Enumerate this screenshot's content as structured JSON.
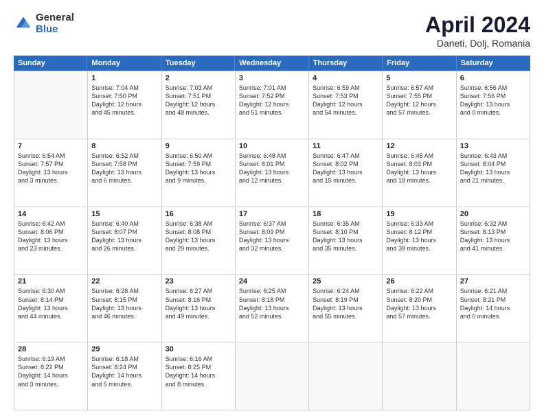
{
  "logo": {
    "general": "General",
    "blue": "Blue"
  },
  "title": {
    "month": "April 2024",
    "location": "Daneti, Dolj, Romania"
  },
  "header": {
    "days": [
      "Sunday",
      "Monday",
      "Tuesday",
      "Wednesday",
      "Thursday",
      "Friday",
      "Saturday"
    ]
  },
  "weeks": [
    [
      {
        "num": "",
        "lines": []
      },
      {
        "num": "1",
        "lines": [
          "Sunrise: 7:04 AM",
          "Sunset: 7:50 PM",
          "Daylight: 12 hours",
          "and 45 minutes."
        ]
      },
      {
        "num": "2",
        "lines": [
          "Sunrise: 7:03 AM",
          "Sunset: 7:51 PM",
          "Daylight: 12 hours",
          "and 48 minutes."
        ]
      },
      {
        "num": "3",
        "lines": [
          "Sunrise: 7:01 AM",
          "Sunset: 7:52 PM",
          "Daylight: 12 hours",
          "and 51 minutes."
        ]
      },
      {
        "num": "4",
        "lines": [
          "Sunrise: 6:59 AM",
          "Sunset: 7:53 PM",
          "Daylight: 12 hours",
          "and 54 minutes."
        ]
      },
      {
        "num": "5",
        "lines": [
          "Sunrise: 6:57 AM",
          "Sunset: 7:55 PM",
          "Daylight: 12 hours",
          "and 57 minutes."
        ]
      },
      {
        "num": "6",
        "lines": [
          "Sunrise: 6:56 AM",
          "Sunset: 7:56 PM",
          "Daylight: 13 hours",
          "and 0 minutes."
        ]
      }
    ],
    [
      {
        "num": "7",
        "lines": [
          "Sunrise: 6:54 AM",
          "Sunset: 7:57 PM",
          "Daylight: 13 hours",
          "and 3 minutes."
        ]
      },
      {
        "num": "8",
        "lines": [
          "Sunrise: 6:52 AM",
          "Sunset: 7:58 PM",
          "Daylight: 13 hours",
          "and 6 minutes."
        ]
      },
      {
        "num": "9",
        "lines": [
          "Sunrise: 6:50 AM",
          "Sunset: 7:59 PM",
          "Daylight: 13 hours",
          "and 9 minutes."
        ]
      },
      {
        "num": "10",
        "lines": [
          "Sunrise: 6:48 AM",
          "Sunset: 8:01 PM",
          "Daylight: 13 hours",
          "and 12 minutes."
        ]
      },
      {
        "num": "11",
        "lines": [
          "Sunrise: 6:47 AM",
          "Sunset: 8:02 PM",
          "Daylight: 13 hours",
          "and 15 minutes."
        ]
      },
      {
        "num": "12",
        "lines": [
          "Sunrise: 6:45 AM",
          "Sunset: 8:03 PM",
          "Daylight: 13 hours",
          "and 18 minutes."
        ]
      },
      {
        "num": "13",
        "lines": [
          "Sunrise: 6:43 AM",
          "Sunset: 8:04 PM",
          "Daylight: 13 hours",
          "and 21 minutes."
        ]
      }
    ],
    [
      {
        "num": "14",
        "lines": [
          "Sunrise: 6:42 AM",
          "Sunset: 8:06 PM",
          "Daylight: 13 hours",
          "and 23 minutes."
        ]
      },
      {
        "num": "15",
        "lines": [
          "Sunrise: 6:40 AM",
          "Sunset: 8:07 PM",
          "Daylight: 13 hours",
          "and 26 minutes."
        ]
      },
      {
        "num": "16",
        "lines": [
          "Sunrise: 6:38 AM",
          "Sunset: 8:08 PM",
          "Daylight: 13 hours",
          "and 29 minutes."
        ]
      },
      {
        "num": "17",
        "lines": [
          "Sunrise: 6:37 AM",
          "Sunset: 8:09 PM",
          "Daylight: 13 hours",
          "and 32 minutes."
        ]
      },
      {
        "num": "18",
        "lines": [
          "Sunrise: 6:35 AM",
          "Sunset: 8:10 PM",
          "Daylight: 13 hours",
          "and 35 minutes."
        ]
      },
      {
        "num": "19",
        "lines": [
          "Sunrise: 6:33 AM",
          "Sunset: 8:12 PM",
          "Daylight: 13 hours",
          "and 38 minutes."
        ]
      },
      {
        "num": "20",
        "lines": [
          "Sunrise: 6:32 AM",
          "Sunset: 8:13 PM",
          "Daylight: 13 hours",
          "and 41 minutes."
        ]
      }
    ],
    [
      {
        "num": "21",
        "lines": [
          "Sunrise: 6:30 AM",
          "Sunset: 8:14 PM",
          "Daylight: 13 hours",
          "and 44 minutes."
        ]
      },
      {
        "num": "22",
        "lines": [
          "Sunrise: 6:28 AM",
          "Sunset: 8:15 PM",
          "Daylight: 13 hours",
          "and 46 minutes."
        ]
      },
      {
        "num": "23",
        "lines": [
          "Sunrise: 6:27 AM",
          "Sunset: 8:16 PM",
          "Daylight: 13 hours",
          "and 49 minutes."
        ]
      },
      {
        "num": "24",
        "lines": [
          "Sunrise: 6:25 AM",
          "Sunset: 8:18 PM",
          "Daylight: 13 hours",
          "and 52 minutes."
        ]
      },
      {
        "num": "25",
        "lines": [
          "Sunrise: 6:24 AM",
          "Sunset: 8:19 PM",
          "Daylight: 13 hours",
          "and 55 minutes."
        ]
      },
      {
        "num": "26",
        "lines": [
          "Sunrise: 6:22 AM",
          "Sunset: 8:20 PM",
          "Daylight: 13 hours",
          "and 57 minutes."
        ]
      },
      {
        "num": "27",
        "lines": [
          "Sunrise: 6:21 AM",
          "Sunset: 8:21 PM",
          "Daylight: 14 hours",
          "and 0 minutes."
        ]
      }
    ],
    [
      {
        "num": "28",
        "lines": [
          "Sunrise: 6:19 AM",
          "Sunset: 8:22 PM",
          "Daylight: 14 hours",
          "and 3 minutes."
        ]
      },
      {
        "num": "29",
        "lines": [
          "Sunrise: 6:18 AM",
          "Sunset: 8:24 PM",
          "Daylight: 14 hours",
          "and 5 minutes."
        ]
      },
      {
        "num": "30",
        "lines": [
          "Sunrise: 6:16 AM",
          "Sunset: 8:25 PM",
          "Daylight: 14 hours",
          "and 8 minutes."
        ]
      },
      {
        "num": "",
        "lines": []
      },
      {
        "num": "",
        "lines": []
      },
      {
        "num": "",
        "lines": []
      },
      {
        "num": "",
        "lines": []
      }
    ]
  ]
}
